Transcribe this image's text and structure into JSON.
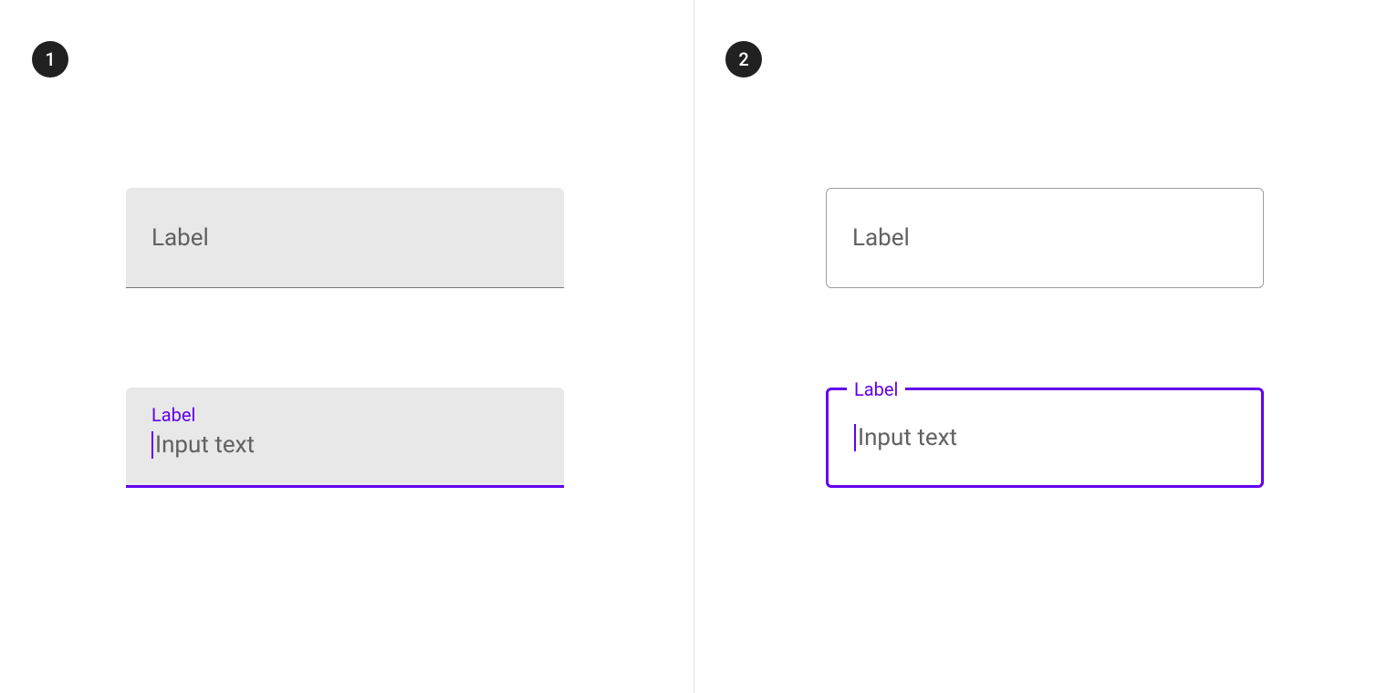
{
  "panels": {
    "left_badge": "1",
    "right_badge": "2"
  },
  "filled": {
    "inactive_label": "Label",
    "focused_label": "Label",
    "focused_placeholder": "Input text"
  },
  "outlined": {
    "inactive_label": "Label",
    "focused_label": "Label",
    "focused_placeholder": "Input text"
  },
  "colors": {
    "primary": "#6200ee",
    "fill": "#e8e8e8",
    "text_secondary": "#616161",
    "outline": "#9e9e9e",
    "badge_bg": "#212121"
  }
}
